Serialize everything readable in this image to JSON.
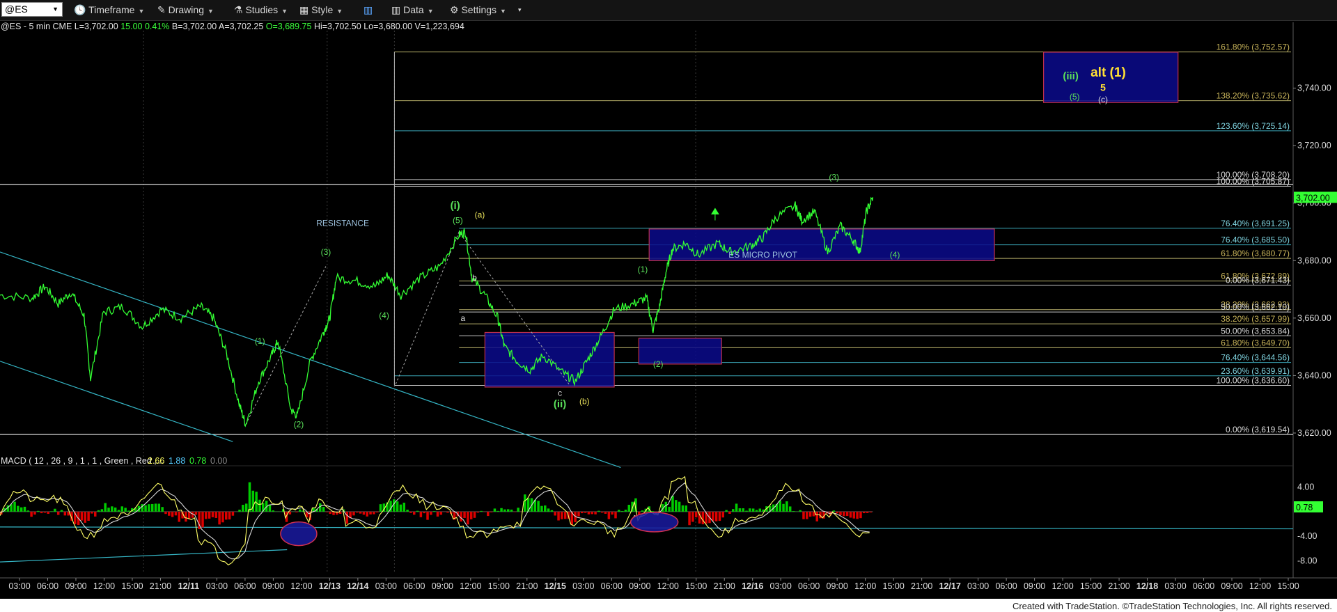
{
  "toolbar": {
    "symbol": "@ES",
    "timeframe": "Timeframe",
    "drawing": "Drawing",
    "studies": "Studies",
    "style": "Style",
    "data": "Data",
    "settings": "Settings"
  },
  "quote": {
    "prefix": "@ES - 5 min  CME",
    "last": "L=3,702.00",
    "change": "15.00",
    "pct": "0.41%",
    "bid": "B=3,702.00",
    "ask": "A=3,702.25",
    "open": "O=3,689.75",
    "high": "Hi=3,702.50",
    "low": "Lo=3,680.00",
    "volume": "V=1,223,694"
  },
  "footer": "Created with TradeStation. ©TradeStation Technologies, Inc. All rights reserved.",
  "colors": {
    "price": "#33ff33",
    "macd": "#ffff66",
    "signal": "#33cc33",
    "hist_up": "#00cc00",
    "hist_down": "#dd0000",
    "box": "#0a0a8c",
    "box_border": "#c0304c",
    "fib": "#b0b080",
    "trend": "#35b6c6"
  },
  "chart_data": {
    "type": "line",
    "title": "@ES - 5 min",
    "ylim": [
      3612,
      3760
    ],
    "y_ticks": [
      "3,740.00",
      "3,720.00",
      "3,700.00",
      "3,680.00",
      "3,660.00",
      "3,640.00",
      "3,620.00"
    ],
    "last_price_tag": "3,702.00",
    "x_labels": [
      "03:00",
      "06:00",
      "09:00",
      "12:00",
      "15:00",
      "21:00",
      "12/11",
      "03:00",
      "06:00",
      "09:00",
      "12:00",
      "12/13",
      "12/14",
      "03:00",
      "06:00",
      "09:00",
      "12:00",
      "15:00",
      "21:00",
      "12/15",
      "03:00",
      "06:00",
      "09:00",
      "12:00",
      "15:00",
      "21:00",
      "12/16",
      "03:00",
      "06:00",
      "09:00",
      "12:00",
      "15:00",
      "21:00",
      "12/17",
      "03:00",
      "06:00",
      "09:00",
      "12:00",
      "15:00",
      "21:00",
      "12/18",
      "03:00",
      "06:00",
      "09:00",
      "12:00",
      "15:00"
    ],
    "price_series": [
      [
        0,
        3668
      ],
      [
        0.025,
        3667
      ],
      [
        0.035,
        3671
      ],
      [
        0.045,
        3665
      ],
      [
        0.055,
        3669
      ],
      [
        0.065,
        3661
      ],
      [
        0.07,
        3639
      ],
      [
        0.08,
        3662
      ],
      [
        0.095,
        3664
      ],
      [
        0.11,
        3657
      ],
      [
        0.125,
        3663
      ],
      [
        0.14,
        3660
      ],
      [
        0.155,
        3664
      ],
      [
        0.165,
        3660
      ],
      [
        0.175,
        3648
      ],
      [
        0.185,
        3630
      ],
      [
        0.19,
        3623
      ],
      [
        0.2,
        3638
      ],
      [
        0.21,
        3647
      ],
      [
        0.215,
        3652
      ],
      [
        0.225,
        3628
      ],
      [
        0.23,
        3626
      ],
      [
        0.24,
        3645
      ],
      [
        0.25,
        3655
      ],
      [
        0.255,
        3660
      ],
      [
        0.26,
        3674
      ],
      [
        0.275,
        3673
      ],
      [
        0.29,
        3671
      ],
      [
        0.3,
        3675
      ],
      [
        0.31,
        3668
      ],
      [
        0.325,
        3674
      ],
      [
        0.34,
        3678
      ],
      [
        0.355,
        3689
      ],
      [
        0.36,
        3690
      ],
      [
        0.365,
        3674
      ],
      [
        0.375,
        3668
      ],
      [
        0.385,
        3660
      ],
      [
        0.39,
        3650
      ],
      [
        0.4,
        3645
      ],
      [
        0.41,
        3642
      ],
      [
        0.42,
        3647
      ],
      [
        0.435,
        3641
      ],
      [
        0.445,
        3638
      ],
      [
        0.455,
        3646
      ],
      [
        0.465,
        3654
      ],
      [
        0.475,
        3663
      ],
      [
        0.49,
        3665
      ],
      [
        0.5,
        3667
      ],
      [
        0.505,
        3656
      ],
      [
        0.51,
        3664
      ],
      [
        0.515,
        3676
      ],
      [
        0.52,
        3684
      ],
      [
        0.53,
        3686
      ],
      [
        0.54,
        3682
      ],
      [
        0.555,
        3686
      ],
      [
        0.565,
        3683
      ],
      [
        0.58,
        3685
      ],
      [
        0.59,
        3688
      ],
      [
        0.6,
        3695
      ],
      [
        0.615,
        3699
      ],
      [
        0.62,
        3694
      ],
      [
        0.63,
        3697
      ],
      [
        0.64,
        3683
      ],
      [
        0.65,
        3692
      ],
      [
        0.66,
        3687
      ],
      [
        0.665,
        3683
      ],
      [
        0.67,
        3697
      ],
      [
        0.675,
        3702
      ]
    ],
    "fib_levels": [
      {
        "label": "161.80% (3,752.57)",
        "value": 3752.57
      },
      {
        "label": "138.20% (3,735.62)",
        "value": 3735.62
      },
      {
        "label": "123.60% (3,725.14)",
        "value": 3725.14
      },
      {
        "label": "100.00% (3,708.20)",
        "value": 3708.2
      },
      {
        "label": "100.00% (3,705.87)",
        "value": 3705.87
      },
      {
        "label": "76.40% (3,691.25)",
        "value": 3691.25
      },
      {
        "label": "76.40% (3,685.50)",
        "value": 3685.5
      },
      {
        "label": "61.80% (3,680.77)",
        "value": 3680.77
      },
      {
        "label": "61.80% (3,672.89)",
        "value": 3672.89
      },
      {
        "label": "0.00% (3,671.43)",
        "value": 3671.43
      },
      {
        "label": "38.20% (3,662.93)",
        "value": 3662.93
      },
      {
        "label": "50.00% (3,662.10)",
        "value": 3662.1
      },
      {
        "label": "38.20% (3,657.99)",
        "value": 3657.99
      },
      {
        "label": "50.00% (3,653.84)",
        "value": 3653.84
      },
      {
        "label": "61.80% (3,649.70)",
        "value": 3649.7
      },
      {
        "label": "76.40% (3,644.56)",
        "value": 3644.56
      },
      {
        "label": "23.60% (3,639.91)",
        "value": 3639.91
      },
      {
        "label": "100.00% (3,636.60)",
        "value": 3636.6
      },
      {
        "label": "0.00% (3,619.54)",
        "value": 3619.54
      }
    ],
    "annotations": [
      {
        "text": "RESISTANCE",
        "x": 0.265,
        "y": 3692
      },
      {
        "text": "ES MICRO PIVOT",
        "x": 0.59,
        "y": 3681
      },
      {
        "text": "(i)",
        "x": 0.352,
        "y": 3698
      },
      {
        "text": "(5)",
        "x": 0.354,
        "y": 3693
      },
      {
        "text": "(a)",
        "x": 0.371,
        "y": 3695
      },
      {
        "text": "(3)",
        "x": 0.252,
        "y": 3682
      },
      {
        "text": "(4)",
        "x": 0.297,
        "y": 3660
      },
      {
        "text": "(1)",
        "x": 0.201,
        "y": 3651
      },
      {
        "text": "(2)",
        "x": 0.231,
        "y": 3622
      },
      {
        "text": "b",
        "x": 0.367,
        "y": 3673
      },
      {
        "text": "a",
        "x": 0.358,
        "y": 3659
      },
      {
        "text": "c",
        "x": 0.433,
        "y": 3633
      },
      {
        "text": "(ii)",
        "x": 0.433,
        "y": 3629
      },
      {
        "text": "(b)",
        "x": 0.452,
        "y": 3630
      },
      {
        "text": "(1)",
        "x": 0.497,
        "y": 3676
      },
      {
        "text": "(2)",
        "x": 0.509,
        "y": 3643
      },
      {
        "text": "(3)",
        "x": 0.645,
        "y": 3708
      },
      {
        "text": "(4)",
        "x": 0.692,
        "y": 3681
      },
      {
        "text": "(iii)",
        "x": 0.828,
        "y": 3743
      },
      {
        "text": "alt (1)",
        "x": 0.857,
        "y": 3744
      },
      {
        "text": "5",
        "x": 0.853,
        "y": 3739
      },
      {
        "text": "(5)",
        "x": 0.831,
        "y": 3736
      },
      {
        "text": "(c)",
        "x": 0.853,
        "y": 3735
      }
    ],
    "macd": {
      "label": "MACD ( 12 , 26 , 9 , 1 , 1 , Green , Red ,...",
      "values": [
        "2.66",
        "1.88",
        "0.78",
        "0.00"
      ],
      "y_ticks": [
        "4.00",
        "-4.00",
        "-8.00"
      ],
      "last_tag": "0.78",
      "ylim": [
        -10,
        6
      ]
    }
  }
}
